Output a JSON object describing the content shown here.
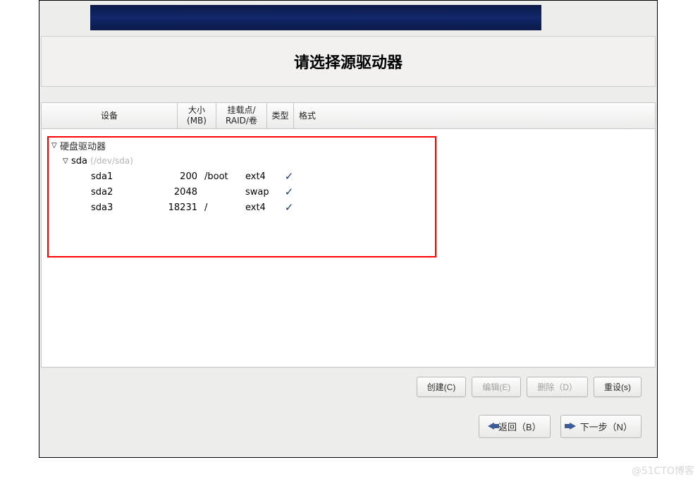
{
  "title": "请选择源驱动器",
  "columns": {
    "device": "设备",
    "size": "大小\n(MB)",
    "mount": "挂载点/\nRAID/卷",
    "type": "类型",
    "fmt": "格式"
  },
  "tree": {
    "root_label": "硬盘驱动器",
    "drive": {
      "name": "sda",
      "path": "(/dev/sda)"
    },
    "partitions": [
      {
        "name": "sda1",
        "size": "200",
        "mount": "/boot",
        "type": "ext4",
        "fmt": true
      },
      {
        "name": "sda2",
        "size": "2048",
        "mount": "",
        "type": "swap",
        "fmt": true
      },
      {
        "name": "sda3",
        "size": "18231",
        "mount": "/",
        "type": "ext4",
        "fmt": true
      }
    ]
  },
  "actions": {
    "create": "创建(C)",
    "edit": "编辑(E)",
    "delete": "删除（D）",
    "reset": "重设(s)"
  },
  "nav": {
    "back": "返回（B）",
    "next": "下一步（N）"
  },
  "watermark": "@51CTO博客"
}
